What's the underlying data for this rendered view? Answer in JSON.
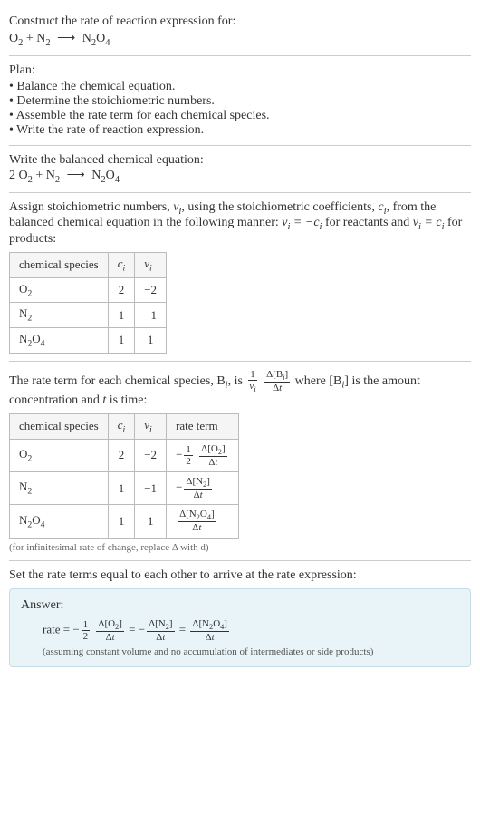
{
  "header": {
    "prompt": "Construct the rate of reaction expression for:",
    "equation_left": "O",
    "equation_left2": " + N",
    "arrow": "⟶",
    "equation_right": "N",
    "sub2": "2",
    "sub4": "4"
  },
  "plan": {
    "title": "Plan:",
    "items": [
      "Balance the chemical equation.",
      "Determine the stoichiometric numbers.",
      "Assemble the rate term for each chemical species.",
      "Write the rate of reaction expression."
    ]
  },
  "balanced": {
    "title": "Write the balanced chemical equation:",
    "coef": "2 O",
    "plus": " + N",
    "arrow": "⟶",
    "product": "N"
  },
  "stoich": {
    "intro_a": "Assign stoichiometric numbers, ",
    "nu_i": "ν",
    "intro_b": ", using the stoichiometric coefficients, ",
    "c_i": "c",
    "intro_c": ", from the balanced chemical equation in the following manner: ",
    "rel1": " = −",
    "intro_d": " for reactants and ",
    "rel2": " = ",
    "intro_e": " for products:",
    "headers": [
      "chemical species",
      "cᵢ",
      "νᵢ"
    ],
    "rows": [
      {
        "species": "O₂",
        "c": "2",
        "nu": "−2"
      },
      {
        "species": "N₂",
        "c": "1",
        "nu": "−1"
      },
      {
        "species": "N₂O₄",
        "c": "1",
        "nu": "1"
      }
    ]
  },
  "rateterm": {
    "intro_a": "The rate term for each chemical species, B",
    "intro_b": ", is ",
    "intro_c": " where [B",
    "intro_d": "] is the amount concentration and ",
    "t": "t",
    "intro_e": " is time:",
    "headers": [
      "chemical species",
      "cᵢ",
      "νᵢ",
      "rate term"
    ],
    "rows": [
      {
        "species": "O₂",
        "c": "2",
        "nu": "−2"
      },
      {
        "species": "N₂",
        "c": "1",
        "nu": "−1"
      },
      {
        "species": "N₂O₄",
        "c": "1",
        "nu": "1"
      }
    ],
    "footnote": "(for infinitesimal rate of change, replace Δ with d)"
  },
  "final": {
    "title": "Set the rate terms equal to each other to arrive at the rate expression:"
  },
  "answer": {
    "label": "Answer:",
    "rate": "rate = ",
    "note": "(assuming constant volume and no accumulation of intermediates or side products)"
  },
  "sym": {
    "i": "i",
    "delta": "Δ",
    "minus": "−",
    "half_num": "1",
    "half_den": "2",
    "one_num": "1"
  }
}
